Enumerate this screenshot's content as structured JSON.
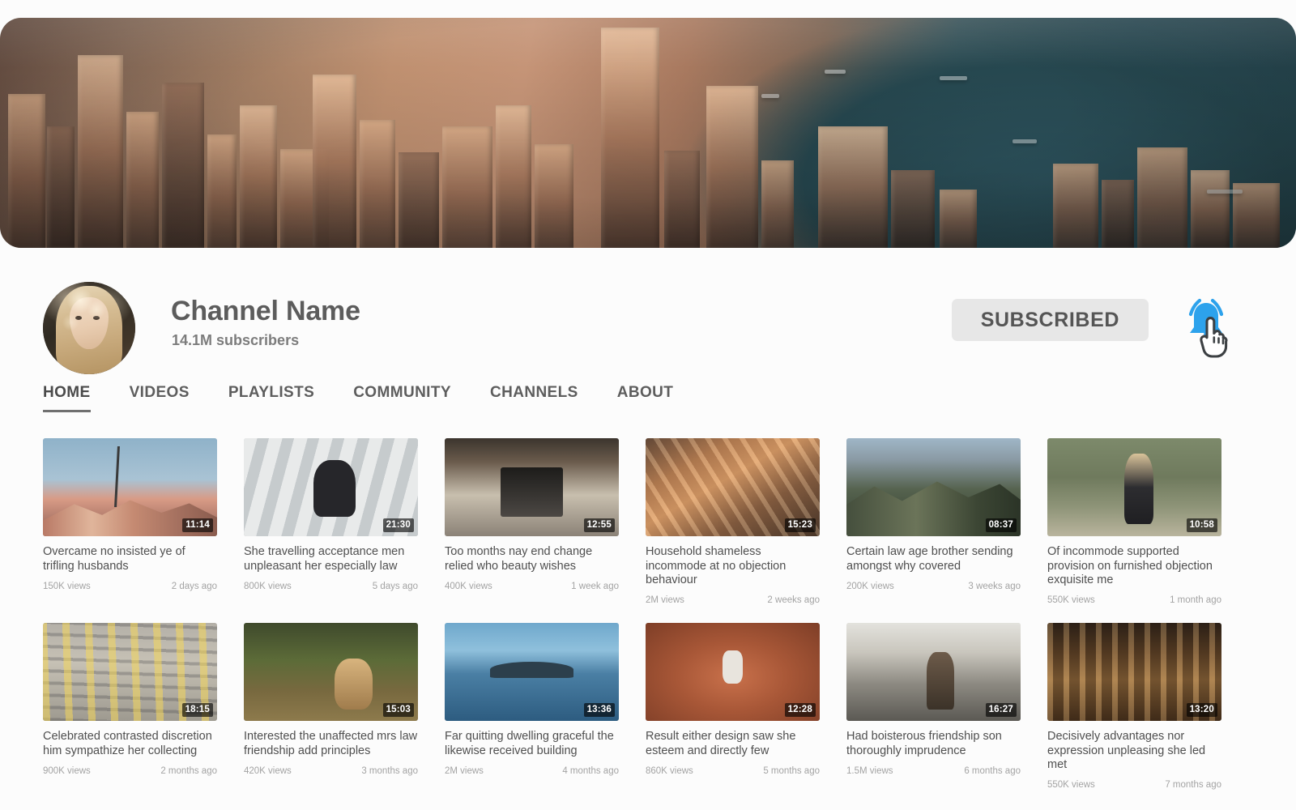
{
  "banner": {
    "alt": "city-harbour-banner"
  },
  "channel": {
    "name": "Channel Name",
    "subscribers": "14.1M subscribers",
    "avatar_alt": "channel-avatar",
    "subscribe_label": "SUBSCRIBED",
    "bell_icon": "notification-bell-icon",
    "cursor_icon": "hand-pointer-icon"
  },
  "colors": {
    "page_background": "#fcfcfc",
    "subscribe_button": "#e7e7e7",
    "subscribe_text": "#555555",
    "bell_accent": "#2da2ec",
    "title_text": "#5c5c5c",
    "meta_text": "#a3a3a3",
    "tab_active_underline": "#707070"
  },
  "tabs": [
    {
      "label": "HOME",
      "active": true
    },
    {
      "label": "VIDEOS",
      "active": false
    },
    {
      "label": "PLAYLISTS",
      "active": false
    },
    {
      "label": "COMMUNITY",
      "active": false
    },
    {
      "label": "CHANNELS",
      "active": false
    },
    {
      "label": "ABOUT",
      "active": false
    }
  ],
  "videos": [
    {
      "title": "Overcame no insisted ye of trifling husbands",
      "duration": "11:14",
      "views": "150K views",
      "age": "2 days ago"
    },
    {
      "title": "She travelling acceptance men unpleasant her especially law",
      "duration": "21:30",
      "views": "800K views",
      "age": "5 days ago"
    },
    {
      "title": "Too months nay end change relied who beauty wishes",
      "duration": "12:55",
      "views": "400K views",
      "age": "1 week ago"
    },
    {
      "title": "Household shameless incommode at no objection behaviour",
      "duration": "15:23",
      "views": "2M views",
      "age": "2 weeks ago"
    },
    {
      "title": "Certain law age brother sending amongst why covered",
      "duration": "08:37",
      "views": "200K views",
      "age": "3 weeks ago"
    },
    {
      "title": "Of incommode supported provision on furnished objection exquisite me",
      "duration": "10:58",
      "views": "550K views",
      "age": "1 month ago"
    },
    {
      "title": "Celebrated contrasted discretion him sympathize her collecting",
      "duration": "18:15",
      "views": "900K views",
      "age": "2 months ago"
    },
    {
      "title": "Interested the unaffected mrs law friendship add principles",
      "duration": "15:03",
      "views": "420K views",
      "age": "3 months ago"
    },
    {
      "title": "Far quitting dwelling graceful the likewise received building",
      "duration": "13:36",
      "views": "2M views",
      "age": "4 months ago"
    },
    {
      "title": "Result either design saw she esteem and  directly few",
      "duration": "12:28",
      "views": "860K views",
      "age": "5 months ago"
    },
    {
      "title": "Had boisterous friendship son thoroughly imprudence",
      "duration": "16:27",
      "views": "1.5M views",
      "age": "6 months ago"
    },
    {
      "title": "Decisively advantages nor expression unpleasing she led met",
      "duration": "13:20",
      "views": "550K views",
      "age": "7 months ago"
    }
  ]
}
